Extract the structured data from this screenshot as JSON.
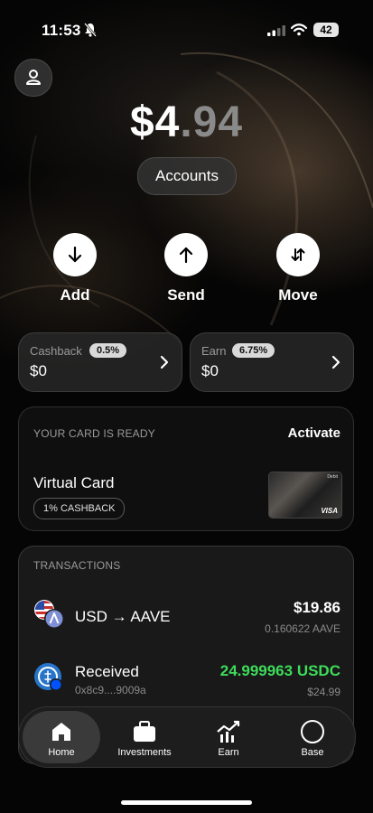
{
  "status_bar": {
    "time": "11:53",
    "battery": "42"
  },
  "header": {
    "profile_icon": "person-icon"
  },
  "balance": {
    "whole": "$4",
    "cents": ".94"
  },
  "accounts_label": "Accounts",
  "actions": [
    {
      "label": "Add",
      "icon": "arrow-down-icon"
    },
    {
      "label": "Send",
      "icon": "arrow-up-icon"
    },
    {
      "label": "Move",
      "icon": "swap-arrows-icon"
    }
  ],
  "cashback": {
    "label": "Cashback",
    "rate": "0.5%",
    "value": "$0"
  },
  "earn": {
    "label": "Earn",
    "rate": "6.75%",
    "value": "$0"
  },
  "card_ready": {
    "heading": "YOUR CARD IS READY",
    "activate_label": "Activate",
    "card_name": "Virtual Card",
    "cashback_tag": "1% CASHBACK",
    "card_brand": "VISA",
    "card_type": "Debit"
  },
  "transactions": {
    "heading": "TRANSACTIONS",
    "items": [
      {
        "title": "USD → AAVE",
        "subtitle": "",
        "amount": "$19.86",
        "amount_secondary": "0.160622 AAVE",
        "amount_color": "#ffffff"
      },
      {
        "title": "Received",
        "subtitle": "0x8c9....9009a",
        "amount": "24.999963 USDC",
        "amount_secondary": "$24.99",
        "amount_color": "#3ddc5a"
      }
    ]
  },
  "nav": [
    {
      "label": "Home",
      "icon": "home-icon",
      "active": true
    },
    {
      "label": "Investments",
      "icon": "briefcase-icon",
      "active": false
    },
    {
      "label": "Earn",
      "icon": "growth-chart-icon",
      "active": false
    },
    {
      "label": "Base",
      "icon": "circle-icon",
      "active": false
    }
  ]
}
